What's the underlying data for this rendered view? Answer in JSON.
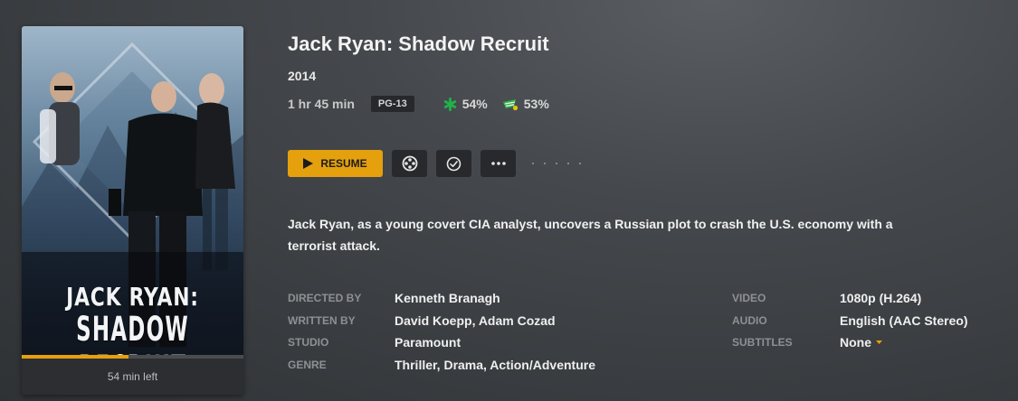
{
  "poster": {
    "title_line1": "JACK RYAN:",
    "title_line2": "SHADOW RECRUIT",
    "progress": 0.48,
    "time_left": "54 min left"
  },
  "movie": {
    "title": "Jack Ryan: Shadow Recruit",
    "year": "2014",
    "runtime": "1 hr 45 min",
    "content_rating": "PG-13",
    "critic_score": "54%",
    "audience_score": "53%",
    "summary": "Jack Ryan, as a young covert CIA analyst, uncovers a Russian plot to crash the U.S. economy with a terrorist attack."
  },
  "actions": {
    "resume_label": "RESUME",
    "trailer_icon": "film-reel-icon",
    "watched_icon": "check-circle-icon",
    "more_icon": "ellipsis-icon"
  },
  "details": {
    "directed_by_label": "DIRECTED BY",
    "directed_by": "Kenneth Branagh",
    "written_by_label": "WRITTEN BY",
    "written_by": "David Koepp, Adam Cozad",
    "studio_label": "STUDIO",
    "studio": "Paramount",
    "genre_label": "GENRE",
    "genre": "Thriller, Drama, Action/Adventure"
  },
  "media": {
    "video_label": "VIDEO",
    "video": "1080p (H.264)",
    "audio_label": "AUDIO",
    "audio": "English (AAC Stereo)",
    "subtitles_label": "SUBTITLES",
    "subtitles": "None"
  },
  "colors": {
    "accent": "#e5a00d",
    "critic_green": "#21b24a",
    "audience_green": "#2fb34a"
  }
}
